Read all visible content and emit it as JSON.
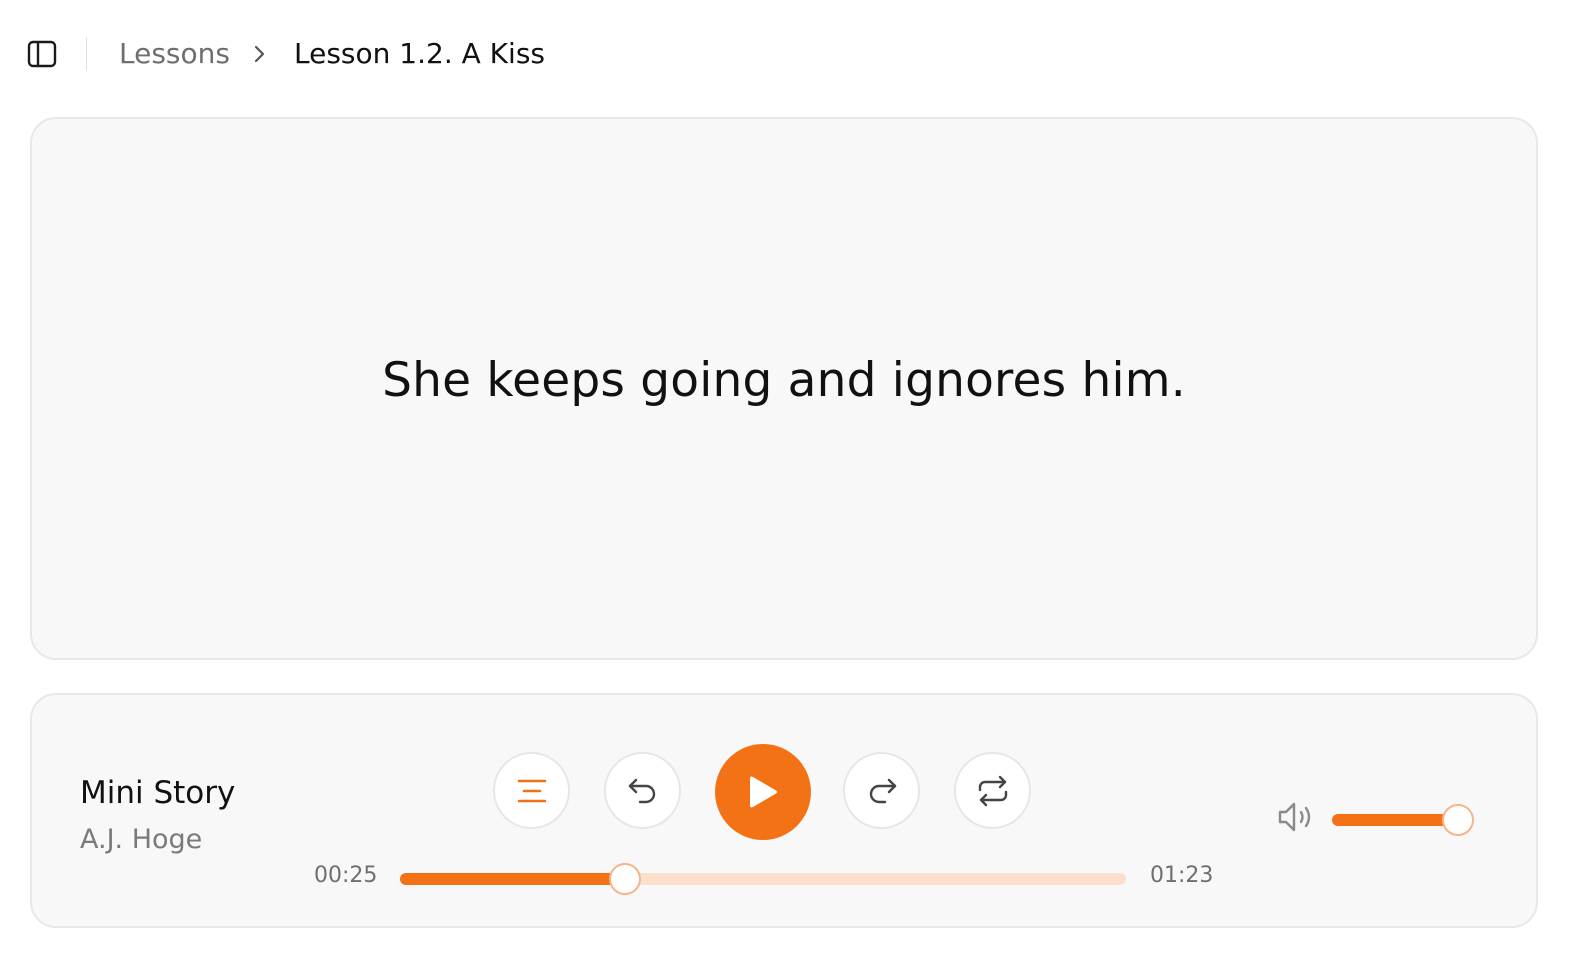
{
  "breadcrumb": {
    "root": "Lessons",
    "current": "Lesson 1.2. A Kiss"
  },
  "card": {
    "sentence": "She keeps going and ignores him."
  },
  "player": {
    "title": "Mini Story",
    "artist": "A.J. Hoge",
    "elapsed": "00:25",
    "total": "01:23",
    "progress_fraction": 0.31,
    "volume_fraction": 0.97
  },
  "icons": {
    "sidebar": "sidebar-panel-icon",
    "separator": "chevron-right-icon",
    "transcript": "align-center-lines-icon",
    "back": "undo-arrow-icon",
    "play": "play-icon",
    "forward": "redo-arrow-icon",
    "repeat": "repeat-icon",
    "volume": "speaker-volume-icon"
  },
  "colors": {
    "accent": "#f47216",
    "accent_light": "#fbdfcc",
    "card_bg": "#f8f8f8",
    "card_border": "#e8e8e8",
    "muted_text": "#6f6f6f"
  }
}
